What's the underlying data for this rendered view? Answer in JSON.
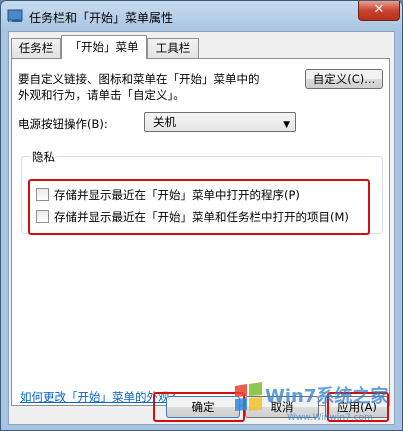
{
  "window": {
    "title": "任务栏和「开始」菜单属性",
    "close_label": "✕"
  },
  "tabs": [
    {
      "label": "任务栏",
      "active": false
    },
    {
      "label": "「开始」菜单",
      "active": true
    },
    {
      "label": "工具栏",
      "active": false
    }
  ],
  "start_menu": {
    "description": "要自定义链接、图标和菜单在「开始」菜单中的\n外观和行为，请单击「自定义」。",
    "customize_button": "自定义(C)...",
    "power_label": "电源按钮操作(B):",
    "power_value": "关机",
    "privacy_group": "隐私",
    "checkboxes": [
      {
        "label": "存储并显示最近在「开始」菜单中打开的程序(P)",
        "checked": false
      },
      {
        "label": "存储并显示最近在「开始」菜单和任务栏中打开的项目(M)",
        "checked": false
      }
    ],
    "help_link": "如何更改「开始」菜单的外观?"
  },
  "footer": {
    "ok": "确定",
    "cancel": "取消",
    "apply": "应用(A)"
  },
  "watermark": {
    "brand": "Win7系统之家",
    "url": "Www.Winwin7.com"
  },
  "colors": {
    "highlight_box": "#d01010",
    "link": "#0066cc",
    "close_button": "#c9452d"
  }
}
